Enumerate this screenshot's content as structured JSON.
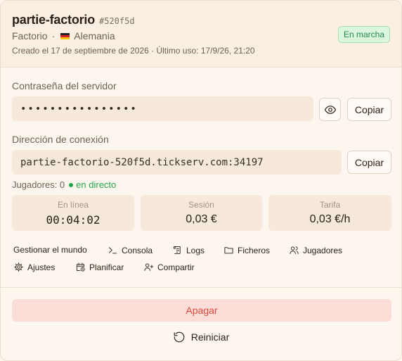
{
  "server": {
    "name": "partie-factorio",
    "hash": "#520f5d",
    "game": "Factorio",
    "separator": "·",
    "region": "Alemania",
    "meta": "Creado el 17 de septiembre de 2026 · Último uso: 17/9/26, 21:20",
    "status": "En marcha",
    "status_color": "#25874a"
  },
  "password": {
    "label": "Contraseña del servidor",
    "masked": "••••••••••••••••",
    "copy_label": "Copiar"
  },
  "connection": {
    "label": "Dirección de conexión",
    "address": "partie-factorio-520f5d.tickserv.com:34197",
    "copy_label": "Copiar"
  },
  "players": {
    "text": "Jugadores: 0",
    "live_label": "en directo"
  },
  "stats": [
    {
      "caption": "En línea",
      "value": "00:04:02"
    },
    {
      "caption": "Sesión",
      "value": "0,03 €"
    },
    {
      "caption": "Tarifa",
      "value": "0,03 €/h"
    }
  ],
  "actions": {
    "manage": "Gestionar el mundo",
    "console": "Consola",
    "logs": "Logs",
    "files": "Ficheros",
    "players": "Jugadores",
    "settings": "Ajustes",
    "schedule": "Planificar",
    "share": "Compartir"
  },
  "footer": {
    "stop_label": "Apagar",
    "stop_color": "#d84a3d",
    "restart_label": "Reiniciar"
  }
}
